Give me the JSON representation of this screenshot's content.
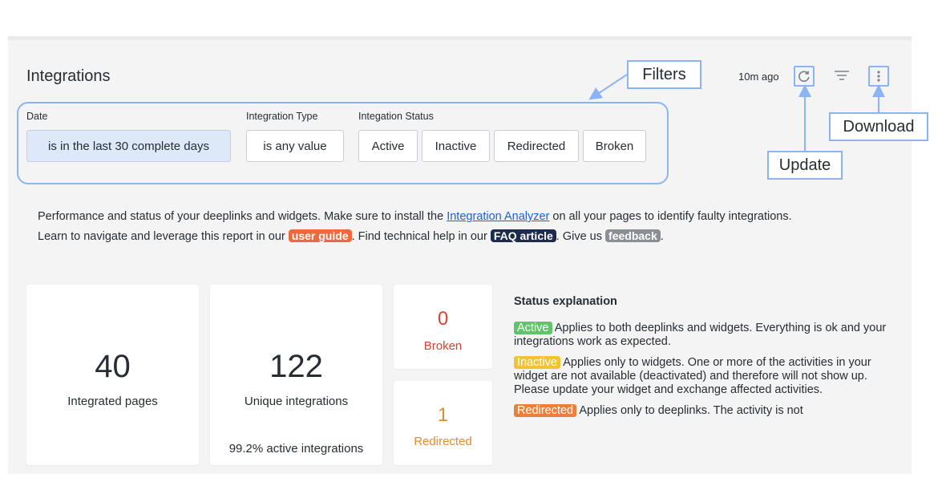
{
  "header": {
    "title": "Integrations",
    "time_ago": "10m ago",
    "icons": {
      "refresh": "refresh-icon",
      "filter": "filter-lines-icon",
      "more": "vertical-dots-icon"
    }
  },
  "filters": {
    "date": {
      "label": "Date",
      "value": "is in the last 30 complete days"
    },
    "integration_type": {
      "label": "Integration Type",
      "value": "is any value"
    },
    "integration_status": {
      "label": "Integation Status",
      "options": [
        "Active",
        "Inactive",
        "Redirected",
        "Broken"
      ]
    }
  },
  "callouts": {
    "filters": "Filters",
    "download": "Download",
    "update": "Update"
  },
  "description": {
    "line1_prefix": "Performance and status of your deeplinks and widgets. Make sure to install the ",
    "link": "Integration Analyzer",
    "line1_suffix": " on all your pages to identify faulty integrations.",
    "line2_prefix": "Learn to navigate and leverage this report in our ",
    "user_guide": "user guide",
    "line2_mid": ". Find technical help in our ",
    "faq": "FAQ article",
    "line2_mid2": ". Give us ",
    "feedback": "feedback",
    "line2_suffix": "."
  },
  "cards": {
    "integrated_pages": {
      "value": "40",
      "label": "Integrated pages"
    },
    "unique_integrations": {
      "value": "122",
      "label": "Unique integrations",
      "sub": "99.2% active integrations"
    },
    "broken": {
      "value": "0",
      "label": "Broken"
    },
    "redirected": {
      "value": "1",
      "label": "Redirected"
    }
  },
  "status_explanation": {
    "title": "Status explanation",
    "active_tag": "Active",
    "active_text": " Applies to both deeplinks and widgets. Everything is ok and your integrations work as expected.",
    "inactive_tag": "Inactive",
    "inactive_text": " Applies only to widgets. One or more of the activities in your widget are not available (deactivated) and therefore will not show up. Please update your widget and exchange affected activities.",
    "redirected_tag": "Redirected",
    "redirected_text": " Applies only to deeplinks. The activity is not"
  },
  "colors": {
    "callout_border": "#8cb3f5",
    "user_guide": "#ee6a3c",
    "faq": "#1d2b4f",
    "feedback": "#8a8f96",
    "broken": "#d6452e",
    "redirected": "#e78a2e",
    "active_tag": "#63c36b",
    "inactive_tag": "#f2c230",
    "redirected_tag": "#ee7f3a"
  }
}
